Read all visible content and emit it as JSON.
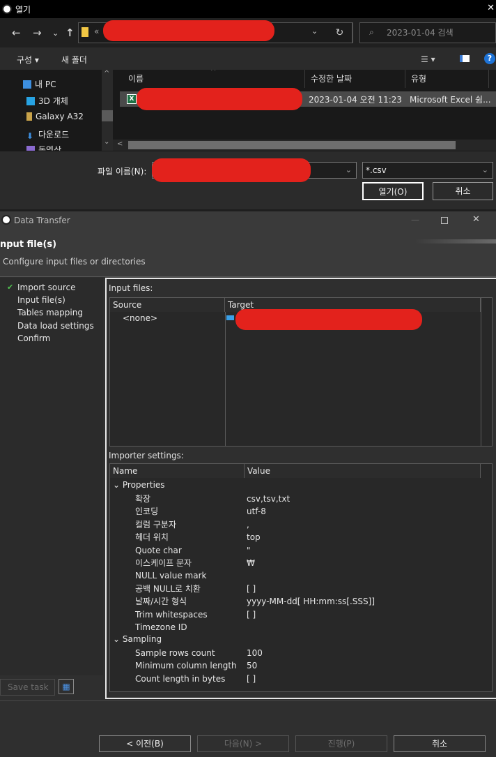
{
  "open_dialog": {
    "title": "열기",
    "close_glyph": "✕",
    "address_prefix": "«",
    "search_placeholder": "2023-01-04 검색",
    "toolbar": {
      "organize": "구성 ▾",
      "new_folder": "새 폴더"
    },
    "tree": [
      {
        "icon": "pc-icon",
        "label": "내 PC"
      },
      {
        "icon": "3d-objects-icon",
        "label": "3D 개체"
      },
      {
        "icon": "phone-icon",
        "label": "Galaxy A32"
      },
      {
        "icon": "download-icon",
        "label": "다운로드"
      },
      {
        "icon": "video-icon",
        "label": "동영상"
      }
    ],
    "columns": {
      "name": "이름",
      "modified": "수정한 날짜",
      "type": "유형"
    },
    "file_row": {
      "modified": "2023-01-04 오전 11:23",
      "type": "Microsoft Excel 쉼..."
    },
    "filename_label": "파일 이름(N):",
    "filter_value": "*.csv",
    "open_button": "열기(O)",
    "cancel_button": "취소"
  },
  "data_transfer": {
    "title": "Data Transfer",
    "header_title": "nput file(s)",
    "header_subtitle": "Configure input files or directories",
    "steps": [
      {
        "label": "Import source",
        "done": true
      },
      {
        "label": "Input file(s)",
        "done": false
      },
      {
        "label": "Tables mapping",
        "done": false
      },
      {
        "label": "Data load settings",
        "done": false
      },
      {
        "label": "Confirm",
        "done": false
      }
    ],
    "input_files_label": "Input files:",
    "input_columns": {
      "source": "Source",
      "target": "Target"
    },
    "input_rows": [
      {
        "source": "<none>"
      }
    ],
    "importer_label": "Importer settings:",
    "importer_columns": {
      "name": "Name",
      "value": "Value"
    },
    "groups": [
      {
        "name": "Properties",
        "rows": [
          {
            "name": "확장",
            "value": "csv,tsv,txt"
          },
          {
            "name": "인코딩",
            "value": "utf-8"
          },
          {
            "name": "컬럼 구분자",
            "value": ","
          },
          {
            "name": "헤더 위치",
            "value": "top"
          },
          {
            "name": "Quote char",
            "value": "\""
          },
          {
            "name": "이스케이프 문자",
            "value": "₩"
          },
          {
            "name": "NULL value mark",
            "value": ""
          },
          {
            "name": "공백 NULL로 치환",
            "value": "[ ]"
          },
          {
            "name": "날짜/시간 형식",
            "value": "yyyy-MM-dd[ HH:mm:ss[.SSS]]"
          },
          {
            "name": "Trim whitespaces",
            "value": "[ ]"
          },
          {
            "name": "Timezone ID",
            "value": ""
          }
        ]
      },
      {
        "name": "Sampling",
        "rows": [
          {
            "name": "Sample rows count",
            "value": "100"
          },
          {
            "name": "Minimum column length",
            "value": "50"
          },
          {
            "name": "Count length in bytes",
            "value": "[ ]"
          }
        ]
      }
    ],
    "save_task": "Save task",
    "buttons": {
      "back": "< 이전(B)",
      "next": "다음(N) >",
      "proceed": "진행(P)",
      "cancel": "취소"
    }
  }
}
